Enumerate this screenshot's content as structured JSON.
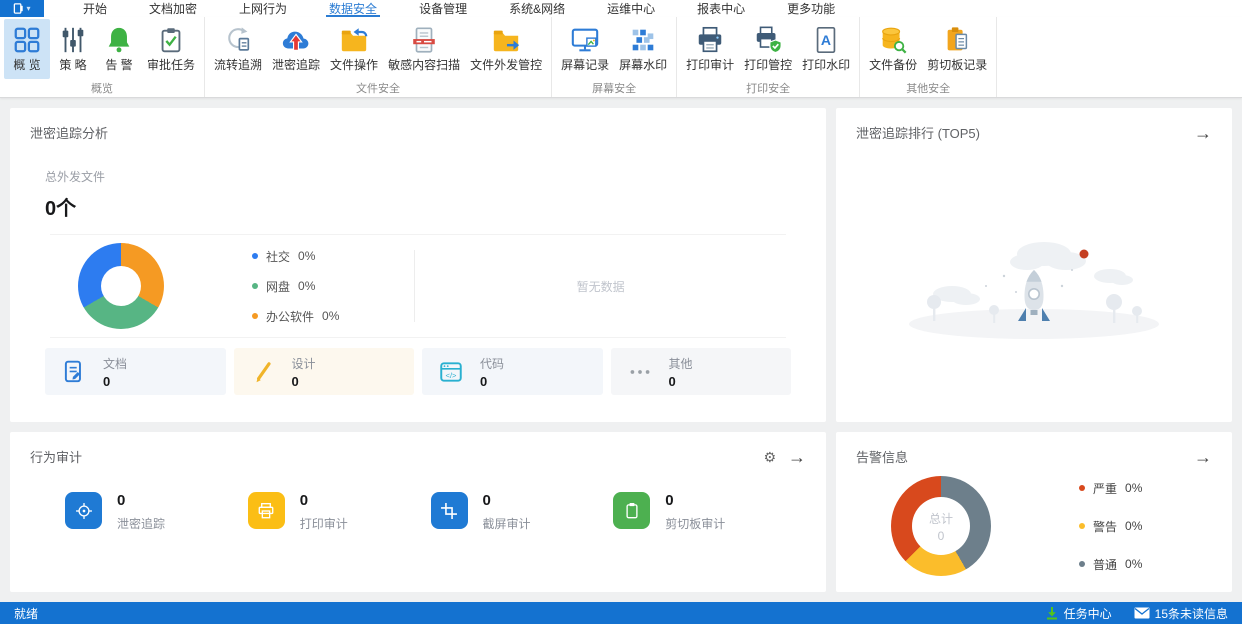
{
  "menu": {
    "tabs": [
      "开始",
      "文档加密",
      "上网行为",
      "数据安全",
      "设备管理",
      "系统&网络",
      "运维中心",
      "报表中心",
      "更多功能"
    ],
    "active_tab": "数据安全"
  },
  "ribbon": {
    "groups": [
      {
        "label": "概览",
        "buttons": [
          {
            "label": "概 览",
            "icon": "overview-grid-icon",
            "active": true
          },
          {
            "label": "策 略",
            "icon": "policy-sliders-icon"
          },
          {
            "label": "告 警",
            "icon": "alert-bell-icon"
          },
          {
            "label": "审批任务",
            "icon": "approval-clipboard-icon"
          }
        ]
      },
      {
        "label": "文件安全",
        "buttons": [
          {
            "label": "流转追溯",
            "icon": "flow-trace-icon"
          },
          {
            "label": "泄密追踪",
            "icon": "leak-trace-cloud-icon"
          },
          {
            "label": "文件操作",
            "icon": "file-operations-folder-icon"
          },
          {
            "label": "敏感内容扫描",
            "icon": "sensitive-scan-icon"
          },
          {
            "label": "文件外发管控",
            "icon": "outgoing-control-folder-icon"
          }
        ]
      },
      {
        "label": "屏幕安全",
        "buttons": [
          {
            "label": "屏幕记录",
            "icon": "screen-record-icon"
          },
          {
            "label": "屏幕水印",
            "icon": "screen-watermark-icon"
          }
        ]
      },
      {
        "label": "打印安全",
        "buttons": [
          {
            "label": "打印审计",
            "icon": "print-audit-icon"
          },
          {
            "label": "打印管控",
            "icon": "print-control-icon"
          },
          {
            "label": "打印水印",
            "icon": "print-watermark-icon"
          }
        ]
      },
      {
        "label": "其他安全",
        "buttons": [
          {
            "label": "文件备份",
            "icon": "file-backup-icon"
          },
          {
            "label": "剪切板记录",
            "icon": "clipboard-record-icon"
          }
        ]
      }
    ]
  },
  "panels": {
    "trace_analysis": {
      "title": "泄密追踪分析",
      "total_label": "总外发文件",
      "total_value": "0个",
      "donut": {
        "segments": [
          {
            "label": "办公软件",
            "color": "#f59a23",
            "deg": 120
          },
          {
            "label": "网盘",
            "color": "#57b584",
            "deg": 120
          },
          {
            "label": "社交",
            "color": "#2d7cf0",
            "deg": 120
          }
        ]
      },
      "legend": [
        {
          "label": "社交",
          "value": "0%",
          "color": "#2d7cf0"
        },
        {
          "label": "网盘",
          "value": "0%",
          "color": "#57b584"
        },
        {
          "label": "办公软件",
          "value": "0%",
          "color": "#f59a23"
        }
      ],
      "empty_text": "暂无数据",
      "cards": [
        {
          "label": "文档",
          "value": "0",
          "icon": "document-card-icon"
        },
        {
          "label": "设计",
          "value": "0",
          "icon": "design-pencil-icon"
        },
        {
          "label": "代码",
          "value": "0",
          "icon": "code-card-icon"
        },
        {
          "label": "其他",
          "value": "0",
          "icon": "more-dots-icon"
        }
      ]
    },
    "trace_rank": {
      "title": "泄密追踪排行 (TOP5)"
    },
    "behavior_audit": {
      "title": "行为审计",
      "items": [
        {
          "label": "泄密追踪",
          "value": "0",
          "color": "#1f7ad4",
          "icon": "target-icon"
        },
        {
          "label": "打印审计",
          "value": "0",
          "color": "#fbbe15",
          "icon": "printer-icon"
        },
        {
          "label": "截屏审计",
          "value": "0",
          "color": "#1f7ad4",
          "icon": "crop-icon"
        },
        {
          "label": "剪切板审计",
          "value": "0",
          "color": "#4db050",
          "icon": "clipboard-icon"
        }
      ]
    },
    "alerts": {
      "title": "告警信息",
      "center_label": "总计",
      "center_value": "0",
      "donut": {
        "segments": [
          {
            "label": "普通",
            "color": "#6d7f8b",
            "deg": 150
          },
          {
            "label": "警告",
            "color": "#fbbd2b",
            "deg": 75
          },
          {
            "label": "严重",
            "color": "#d8491d",
            "deg": 135
          }
        ]
      },
      "legend": [
        {
          "label": "严重",
          "value": "0%",
          "color": "#d8491d"
        },
        {
          "label": "警告",
          "value": "0%",
          "color": "#fbbd2b"
        },
        {
          "label": "普通",
          "value": "0%",
          "color": "#6d7f8b"
        }
      ]
    }
  },
  "statusbar": {
    "ready_label": "就绪",
    "task_center_label": "任务中心",
    "unread_label": "15条未读信息"
  },
  "colors": {
    "brand_blue": "#1472d0",
    "accent_blue": "#2b7cd3",
    "ribbon_selected_bg": "#cde3f6"
  },
  "chart_data": [
    {
      "type": "pie",
      "title": "外发文件分类占比",
      "labels": [
        "社交",
        "网盘",
        "办公软件"
      ],
      "values": [
        0,
        0,
        0
      ],
      "display_values": [
        "0%",
        "0%",
        "0%"
      ],
      "colors": [
        "#2d7cf0",
        "#57b584",
        "#f59a23"
      ],
      "legend_position": "right",
      "note": "donut placeholder with three equal 120° segments, no data"
    },
    {
      "type": "pie",
      "title": "告警信息",
      "labels": [
        "严重",
        "警告",
        "普通"
      ],
      "values": [
        0,
        0,
        0
      ],
      "display_values": [
        "0%",
        "0%",
        "0%"
      ],
      "colors": [
        "#d8491d",
        "#fbbd2b",
        "#6d7f8b"
      ],
      "center_text": "总计 0",
      "legend_position": "right",
      "note": "donut placeholder segments ≈ 135°/75°/150°, no data"
    }
  ]
}
